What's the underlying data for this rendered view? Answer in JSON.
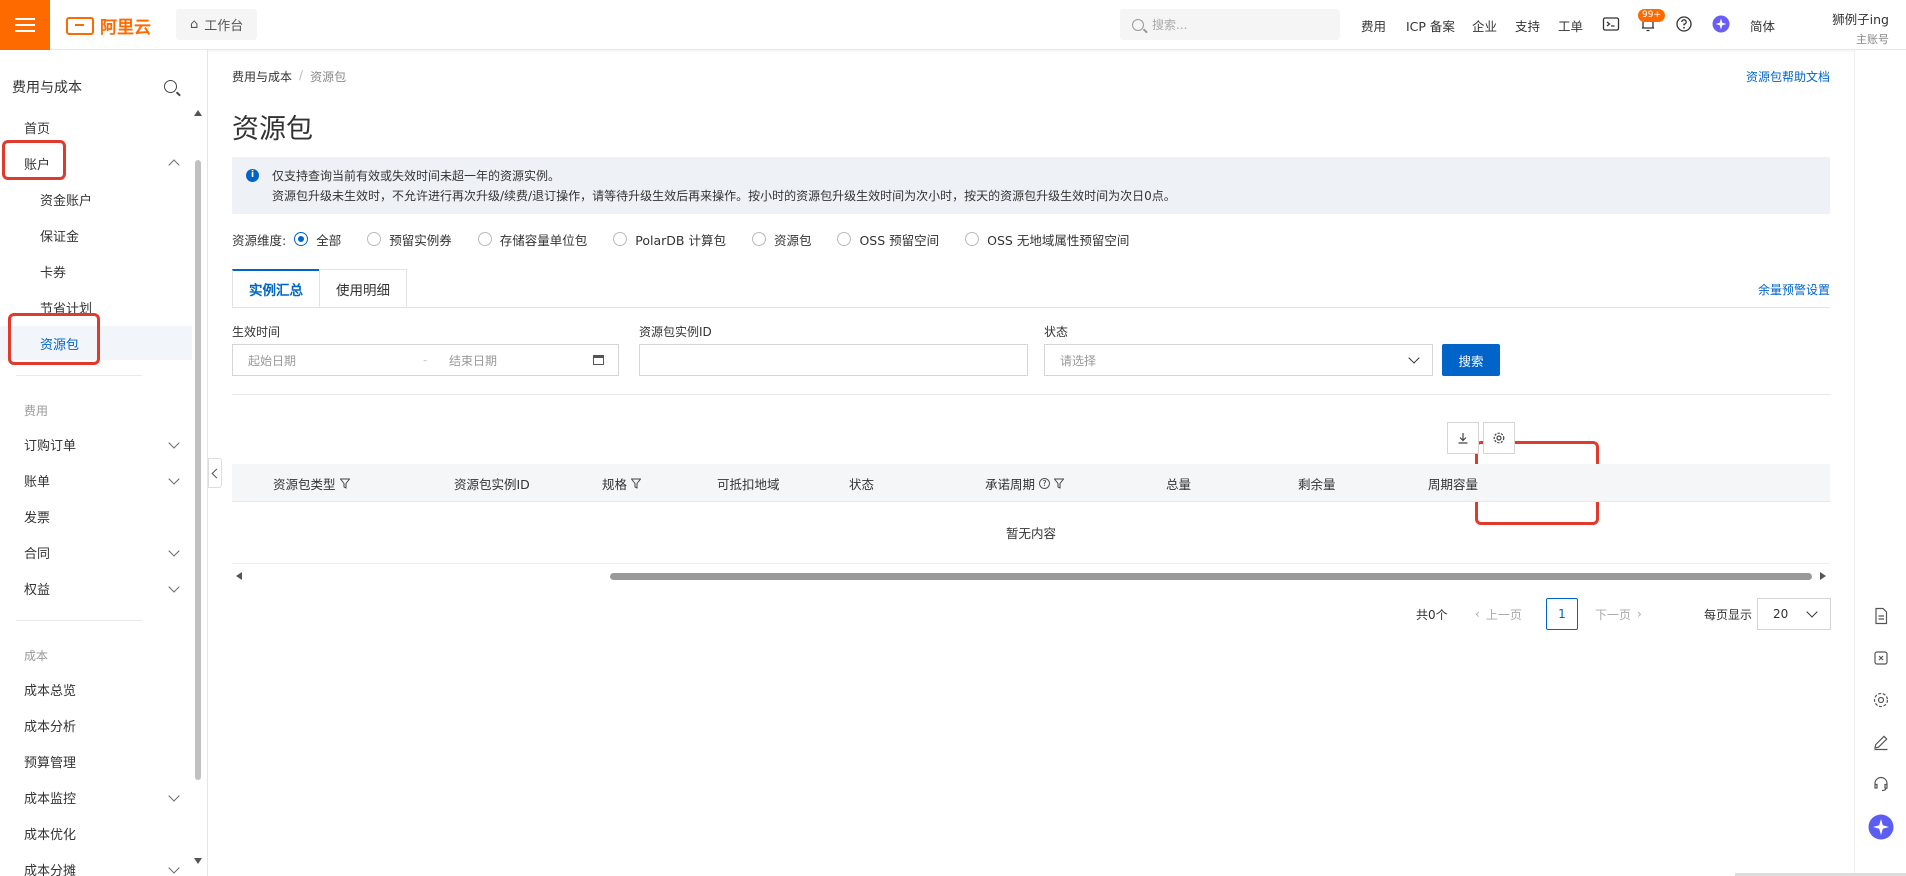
{
  "topbar": {
    "logo_text": "阿里云",
    "workbench": "工作台",
    "search_placeholder": "搜索...",
    "nav": [
      "费用",
      "ICP 备案",
      "企业",
      "支持",
      "工单"
    ],
    "notification_badge": "99+",
    "lang": "简体",
    "user_name": "狮例子ing",
    "user_role": "主账号",
    "brand_color": "#ff6a00"
  },
  "sidebar": {
    "title": "费用与成本",
    "home": "首页",
    "account": "账户",
    "account_children": [
      "资金账户",
      "保证金",
      "卡券",
      "节省计划",
      "资源包"
    ],
    "group_fee": "费用",
    "fee_items": [
      "订购订单",
      "账单",
      "发票",
      "合同",
      "权益"
    ],
    "group_cost": "成本",
    "cost_items": [
      "成本总览",
      "成本分析",
      "预算管理",
      "成本监控",
      "成本优化",
      "成本分摊"
    ]
  },
  "breadcrumb": {
    "parent": "费用与成本",
    "sep": "/",
    "current": "资源包"
  },
  "help_link": "资源包帮助文档",
  "page_title": "资源包",
  "notice": {
    "line1": "仅支持查询当前有效或失效时间未超一年的资源实例。",
    "line2": "资源包升级未生效时，不允许进行再次升级/续费/退订操作，请等待升级生效后再来操作。按小时的资源包升级生效时间为次小时，按天的资源包升级生效时间为次日0点。"
  },
  "dimension": {
    "label": "资源维度:",
    "options": [
      "全部",
      "预留实例券",
      "存储容量单位包",
      "PolarDB 计算包",
      "资源包",
      "OSS 预留空间",
      "OSS 无地域属性预留空间"
    ],
    "selected": "全部"
  },
  "tabs": [
    "实例汇总",
    "使用明细"
  ],
  "alert_settings": "余量预警设置",
  "filters": {
    "time_label": "生效时间",
    "start_placeholder": "起始日期",
    "end_placeholder": "结束日期",
    "date_sep": "-",
    "id_label": "资源包实例ID",
    "status_label": "状态",
    "status_placeholder": "请选择",
    "search_btn": "搜索"
  },
  "table": {
    "columns": [
      "资源包类型",
      "资源包实例ID",
      "规格",
      "可抵扣地域",
      "状态",
      "承诺周期",
      "总量",
      "剩余量",
      "周期容量"
    ],
    "empty": "暂无内容"
  },
  "pagination": {
    "total": "共0个",
    "prev": "上一页",
    "page": "1",
    "next": "下一页",
    "page_size_label": "每页显示",
    "page_size": "20"
  }
}
